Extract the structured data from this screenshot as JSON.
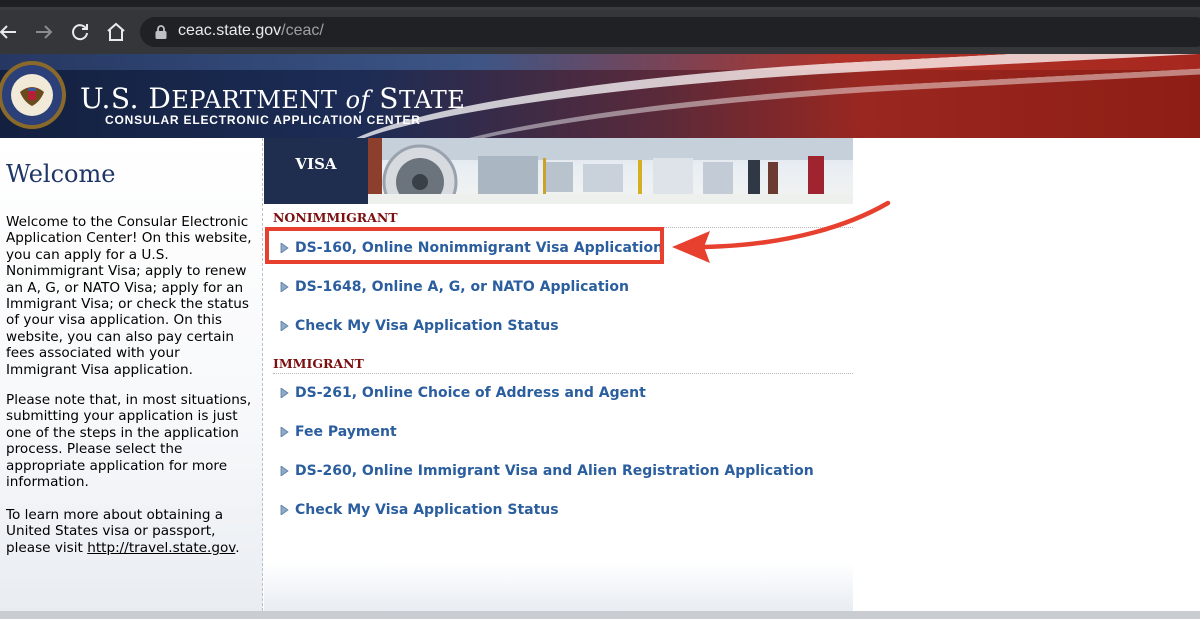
{
  "browser": {
    "url_host": "ceac.state.gov",
    "url_path": "/ceac/"
  },
  "header": {
    "agency_prefix": "U.S. D",
    "agency_rest": "EPARTMENT ",
    "agency_of": "of",
    "agency_s": " S",
    "agency_tate": "TATE",
    "subtitle": "CONSULAR ELECTRONIC APPLICATION CENTER"
  },
  "sidebar": {
    "title": "Welcome",
    "para1": "Welcome to the Consular Electronic Application Center! On this website, you can apply for a U.S. Nonimmigrant Visa; apply to renew an A, G, or NATO Visa; apply for an Immigrant Visa; or check the status of your visa application. On this website, you can also pay certain fees associated with your Immigrant Visa application.",
    "para2": "Please note that, in most situations, submitting your application is just one of the steps in the application process. Please select the appropriate application for more information.",
    "para3_prefix": "To learn more about obtaining a United States visa or passport, please visit ",
    "para3_link": "http://travel.state.gov",
    "para3_suffix": "."
  },
  "main": {
    "tab_label": "VISA",
    "nonimmigrant_heading": "NONIMMIGRANT",
    "immigrant_heading": "IMMIGRANT",
    "nonimmigrant_links": [
      "DS-160, Online Nonimmigrant Visa Application",
      "DS-1648, Online A, G, or NATO Application",
      "Check My Visa Application Status"
    ],
    "immigrant_links": [
      "DS-261, Online Choice of Address and Agent",
      "Fee Payment",
      "DS-260, Online Immigrant Visa and Alien Registration Application",
      "Check My Visa Application Status"
    ]
  },
  "colors": {
    "link_blue": "#2b5e9e",
    "heading_red": "#7c0f0f",
    "annotation_red": "#e8402f",
    "navy": "#1f2d4f"
  }
}
